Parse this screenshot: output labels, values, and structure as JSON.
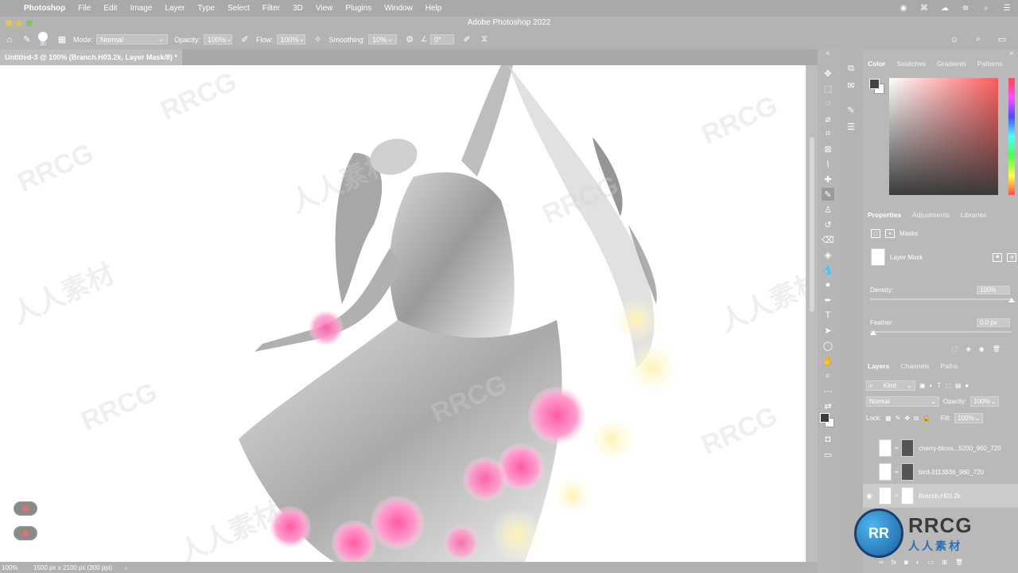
{
  "menubar": {
    "app": "Photoshop",
    "items": [
      "File",
      "Edit",
      "Image",
      "Layer",
      "Type",
      "Select",
      "Filter",
      "3D",
      "View",
      "Plugins",
      "Window",
      "Help"
    ]
  },
  "window": {
    "title": "Adobe Photoshop 2022"
  },
  "options": {
    "brush_size": "30",
    "mode_label": "Mode:",
    "mode_value": "Normal",
    "opacity_label": "Opacity:",
    "opacity_value": "100%",
    "flow_label": "Flow:",
    "flow_value": "100%",
    "smoothing_label": "Smoothing:",
    "smoothing_value": "10%",
    "angle_value": "0°"
  },
  "document": {
    "tab_title": "Untitled-3 @ 100% (Branch.H03.2k, Layer Mask/8) *"
  },
  "status": {
    "zoom": "100%",
    "info": "1500 px x 2100 px (300 ppi)",
    "arrow": "›"
  },
  "panels": {
    "color_tabs": [
      "Color",
      "Swatches",
      "Gradients",
      "Patterns"
    ],
    "props_tabs": [
      "Properties",
      "Adjustments",
      "Libraries"
    ],
    "masks_label": "Masks",
    "layer_mask_label": "Layer Mask",
    "density_label": "Density:",
    "density_value": "100%",
    "density_level": 1.0,
    "feather_label": "Feather:",
    "feather_value": "0.0 px",
    "feather_level": 0.0,
    "layers_tabs": [
      "Layers",
      "Channels",
      "Paths"
    ],
    "kind_label": "Kind",
    "blend_mode": "Normal",
    "opacity_label": "Opacity:",
    "opacity_value": "100%",
    "lock_label": "Lock:",
    "fill_label": "Fill:",
    "fill_value": "100%",
    "layers": [
      {
        "name": "cherry-bloss...5200_960_720",
        "selected": false,
        "visible": false
      },
      {
        "name": "bird-3113836_960_720",
        "selected": false,
        "visible": false
      },
      {
        "name": "Branch.H03.2k",
        "selected": true,
        "visible": true
      }
    ]
  },
  "watermark": {
    "text_latin": "RRCG",
    "text_cn": "人人素材",
    "logo_main": "RRCG",
    "logo_sub": "人人素材"
  },
  "colors": {
    "accent": "#2d6fae",
    "foreground": "#444444",
    "background": "#ffffff"
  }
}
